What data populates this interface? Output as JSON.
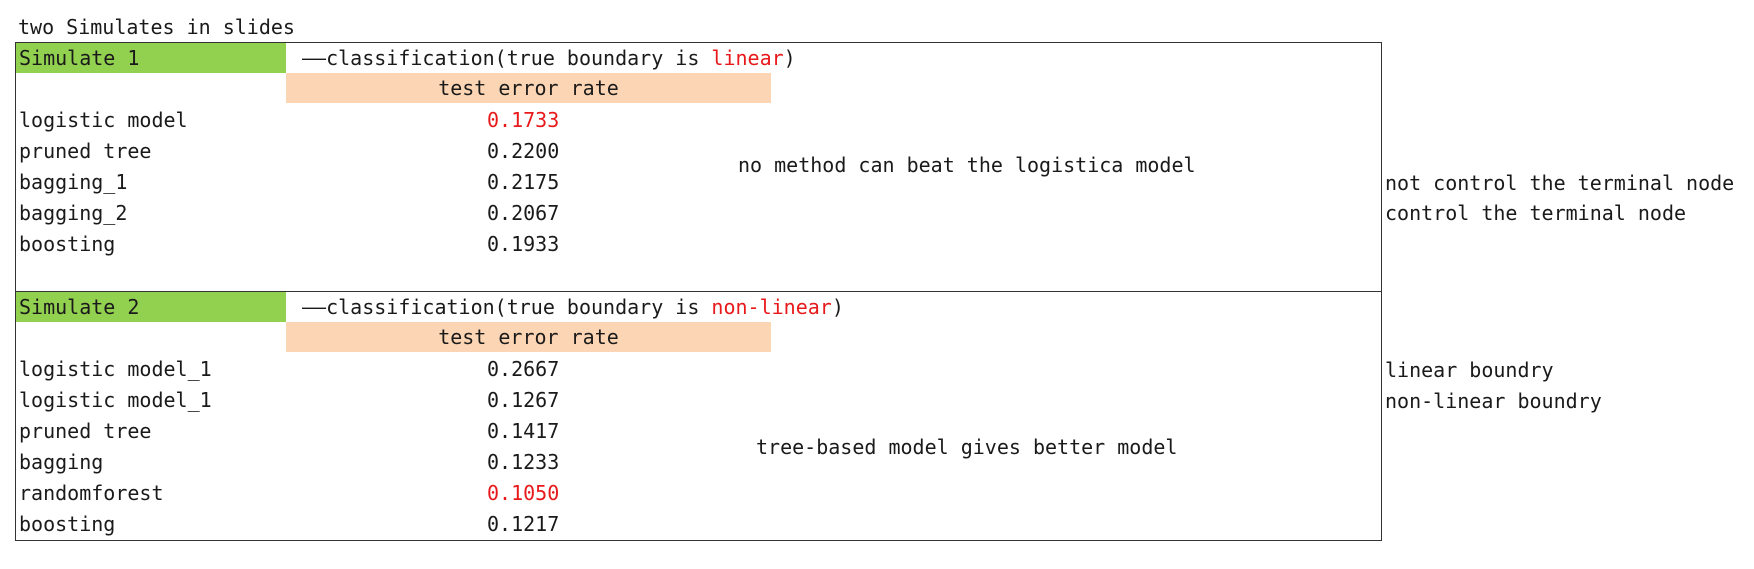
{
  "page": {
    "title": "two Simulates in slides"
  },
  "colors": {
    "label_bg": "#92d050",
    "header_bg": "#fcd5b4",
    "highlight": "#e8191b",
    "border": "#333333"
  },
  "simulations": [
    {
      "label": "Simulate 1",
      "subtitle_prefix": "——classification(true boundary is ",
      "subtitle_highlight": "linear",
      "subtitle_suffix": ")",
      "column_header": "test error rate",
      "rows": [
        {
          "name": "logistic model",
          "value": "0.1733",
          "highlight": true
        },
        {
          "name": "pruned tree",
          "value": "0.2200",
          "highlight": false
        },
        {
          "name": "bagging_1",
          "value": "0.2175",
          "highlight": false
        },
        {
          "name": "bagging_2",
          "value": "0.2067",
          "highlight": false
        },
        {
          "name": "boosting",
          "value": "0.1933",
          "highlight": false
        }
      ],
      "comment": "no method can beat the logistica model",
      "side_notes": [
        "not control the terminal node",
        "control the terminal node"
      ]
    },
    {
      "label": "Simulate 2",
      "subtitle_prefix": "——classification(true boundary is ",
      "subtitle_highlight": "non-linear",
      "subtitle_suffix": ")",
      "column_header": "test error rate",
      "rows": [
        {
          "name": "logistic model_1",
          "value": "0.2667",
          "highlight": false
        },
        {
          "name": "logistic model_1",
          "value": "0.1267",
          "highlight": false
        },
        {
          "name": "pruned tree",
          "value": "0.1417",
          "highlight": false
        },
        {
          "name": "bagging",
          "value": "0.1233",
          "highlight": false
        },
        {
          "name": "randomforest",
          "value": "0.1050",
          "highlight": true
        },
        {
          "name": "boosting",
          "value": "0.1217",
          "highlight": false
        }
      ],
      "comment": "tree-based model gives better model",
      "side_notes": [
        "linear boundry",
        "non-linear boundry"
      ]
    }
  ]
}
